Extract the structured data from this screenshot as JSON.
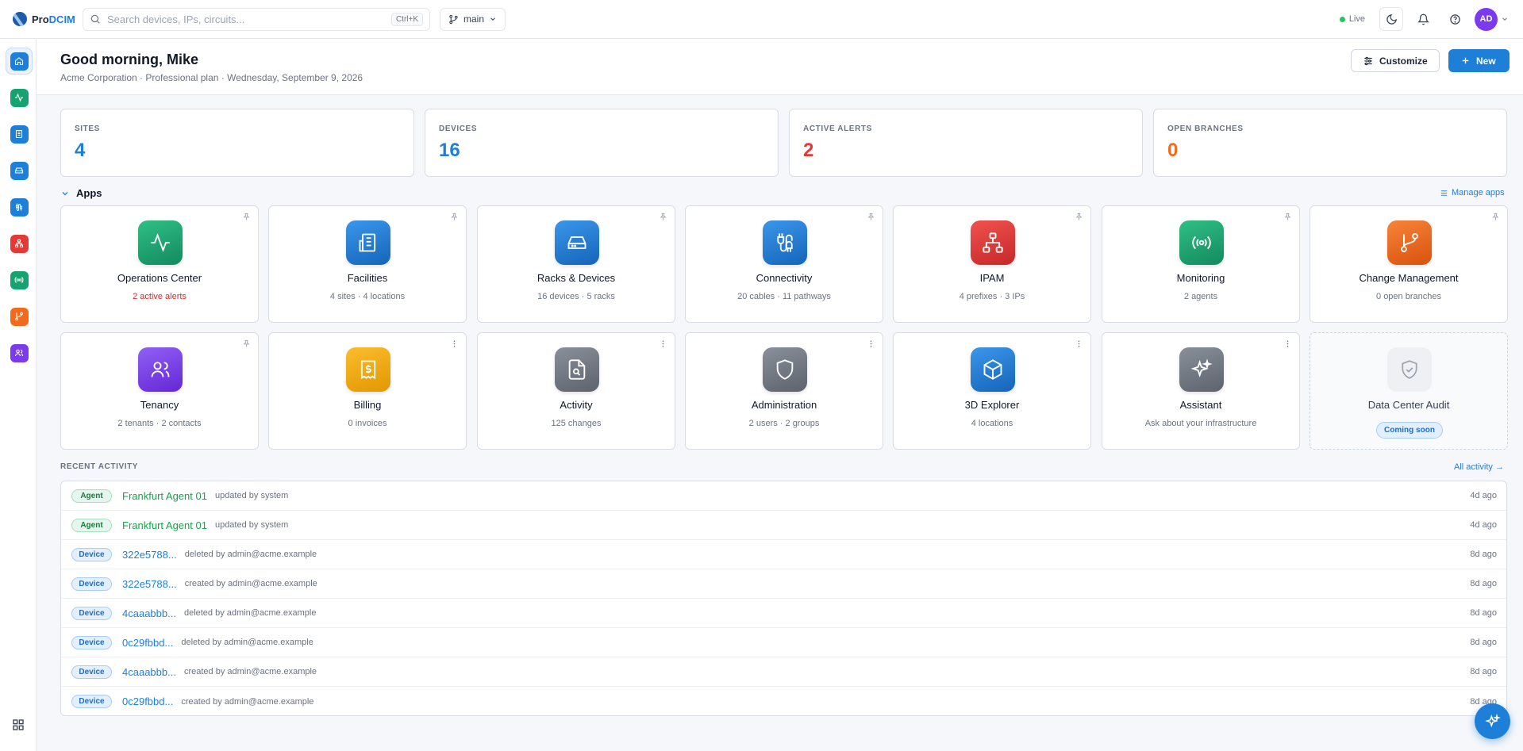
{
  "brand": {
    "prefix": "Pro",
    "suffix": "DCIM"
  },
  "search": {
    "placeholder": "Search devices, IPs, circuits...",
    "shortcut": "Ctrl+K"
  },
  "branch": {
    "name": "main"
  },
  "status": {
    "label": "Live",
    "color": "#22c55e"
  },
  "user": {
    "initials": "AD"
  },
  "sidebar": {
    "items": [
      {
        "name": "home",
        "icon": "home-icon",
        "active": true,
        "color": "#1e7fd8"
      },
      {
        "name": "operations",
        "icon": "activity-icon",
        "color": "#16a372"
      },
      {
        "name": "facilities",
        "icon": "building-icon",
        "color": "#1e7fd8"
      },
      {
        "name": "racks",
        "icon": "server-icon",
        "color": "#1e7fd8"
      },
      {
        "name": "connectivity",
        "icon": "cable-icon",
        "color": "#1e7fd8"
      },
      {
        "name": "ipam",
        "icon": "network-icon",
        "color": "#e53935"
      },
      {
        "name": "monitoring",
        "icon": "radio-icon",
        "color": "#16a372"
      },
      {
        "name": "change-management",
        "icon": "git-branch-icon",
        "color": "#f26b1d"
      },
      {
        "name": "tenancy",
        "icon": "users-icon",
        "color": "#7c3aed"
      }
    ]
  },
  "header": {
    "greeting": "Good morning, Mike",
    "subline": "Acme Corporation · Professional plan · Wednesday, September 9, 2026",
    "customize_label": "Customize",
    "new_label": "New"
  },
  "stats": [
    {
      "label": "SITES",
      "value": "4",
      "color": "#1e7fd8"
    },
    {
      "label": "DEVICES",
      "value": "16",
      "color": "#1e7fd8"
    },
    {
      "label": "ACTIVE ALERTS",
      "value": "2",
      "color": "#e53935"
    },
    {
      "label": "OPEN BRANCHES",
      "value": "0",
      "color": "#f26b1d"
    }
  ],
  "apps": {
    "title": "Apps",
    "manage_label": "Manage apps",
    "items": [
      {
        "name": "Operations Center",
        "sub": "2 active alerts",
        "icon": "activity-icon",
        "color": "#16a372",
        "corner": "pin-icon",
        "alert": true
      },
      {
        "name": "Facilities",
        "sub": "4 sites · 4 locations",
        "icon": "building-icon",
        "color": "#1e7fd8",
        "corner": "pin-icon"
      },
      {
        "name": "Racks & Devices",
        "sub": "16 devices · 5 racks",
        "icon": "server-icon",
        "color": "#1e7fd8",
        "corner": "pin-icon"
      },
      {
        "name": "Connectivity",
        "sub": "20 cables · 11 pathways",
        "icon": "cable-icon",
        "color": "#1e7fd8",
        "corner": "pin-icon"
      },
      {
        "name": "IPAM",
        "sub": "4 prefixes · 3 IPs",
        "icon": "network-icon",
        "color": "#e53935",
        "corner": "pin-icon"
      },
      {
        "name": "Monitoring",
        "sub": "2 agents",
        "icon": "radio-icon",
        "color": "#16a372",
        "corner": "pin-icon"
      },
      {
        "name": "Change Management",
        "sub": "0 open branches",
        "icon": "git-branch-icon",
        "color": "#f26b1d",
        "corner": "pin-icon"
      },
      {
        "name": "Tenancy",
        "sub": "2 tenants · 2 contacts",
        "icon": "users-icon",
        "color": "#7c3aed",
        "corner": "pin-icon"
      },
      {
        "name": "Billing",
        "sub": "0 invoices",
        "icon": "receipt-icon",
        "color": "#f5a70a",
        "corner": "more-icon"
      },
      {
        "name": "Activity",
        "sub": "125 changes",
        "icon": "file-search-icon",
        "color": "#6b7280",
        "corner": "more-icon"
      },
      {
        "name": "Administration",
        "sub": "2 users · 2 groups",
        "icon": "shield-icon",
        "color": "#6b7280",
        "corner": "more-icon"
      },
      {
        "name": "3D Explorer",
        "sub": "4 locations",
        "icon": "cube-icon",
        "color": "#1e7fd8",
        "corner": "more-icon"
      },
      {
        "name": "Assistant",
        "sub": "Ask about your infrastructure",
        "icon": "sparkles-icon",
        "color": "#6b7280",
        "corner": "more-icon"
      },
      {
        "name": "Data Center Audit",
        "badge": "Coming soon",
        "icon": "shield-check-icon",
        "color": "#eef0f3",
        "disabled": true
      }
    ]
  },
  "recent": {
    "title": "RECENT ACTIVITY",
    "all_label": "All activity →",
    "rows": [
      {
        "tag": "Agent",
        "name": "Frankfurt Agent 01",
        "desc": "updated by system",
        "time": "4d ago"
      },
      {
        "tag": "Agent",
        "name": "Frankfurt Agent 01",
        "desc": "updated by system",
        "time": "4d ago"
      },
      {
        "tag": "Device",
        "name": "322e5788...",
        "desc": "deleted by admin@acme.example",
        "time": "8d ago"
      },
      {
        "tag": "Device",
        "name": "322e5788...",
        "desc": "created by admin@acme.example",
        "time": "8d ago"
      },
      {
        "tag": "Device",
        "name": "4caaabbb...",
        "desc": "deleted by admin@acme.example",
        "time": "8d ago"
      },
      {
        "tag": "Device",
        "name": "0c29fbbd...",
        "desc": "deleted by admin@acme.example",
        "time": "8d ago"
      },
      {
        "tag": "Device",
        "name": "4caaabbb...",
        "desc": "created by admin@acme.example",
        "time": "8d ago"
      },
      {
        "tag": "Device",
        "name": "0c29fbbd...",
        "desc": "created by admin@acme.example",
        "time": "8d ago"
      }
    ]
  }
}
